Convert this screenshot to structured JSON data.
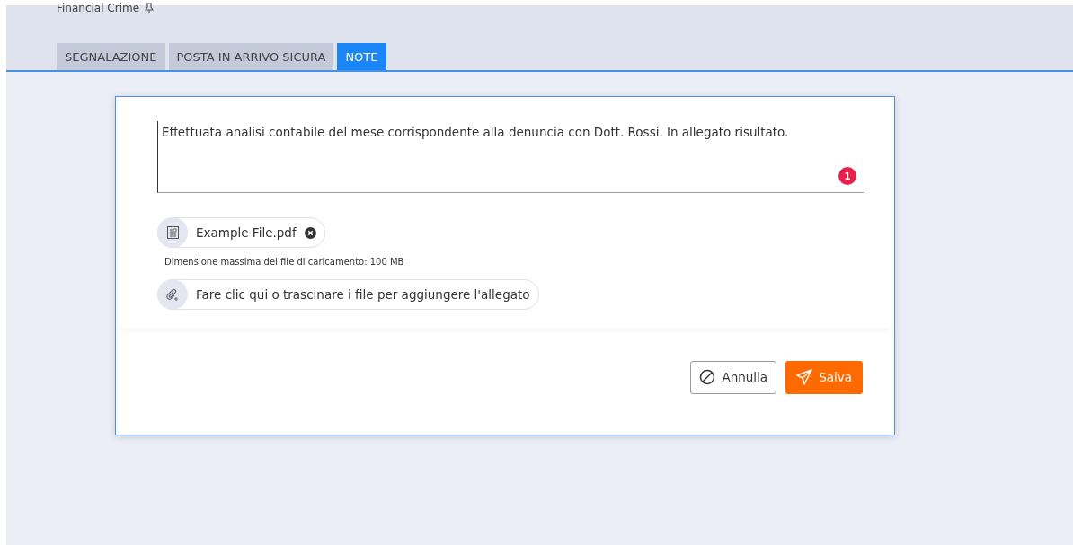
{
  "header": {
    "title": "Financial Crime"
  },
  "tabs": [
    {
      "label": "SEGNALAZIONE",
      "selected": false
    },
    {
      "label": "POSTA IN ARRIVO SICURA",
      "selected": false
    },
    {
      "label": "NOTE",
      "selected": true
    }
  ],
  "note": {
    "value": "Effettuata analisi contabile del mese corrispondente alla denuncia con Dott. Rossi. In allegato risultato.",
    "badge": "1"
  },
  "attachments": [
    {
      "name": "Example File.pdf"
    }
  ],
  "max_size_hint": "Dimensione massima del file di caricamento: 100 MB",
  "upload_label": "Fare clic qui o trascinare i file per aggiungere l'allegato",
  "buttons": [
    {
      "kind": "cancel",
      "label": "Annulla"
    },
    {
      "kind": "save",
      "label": "Salva"
    }
  ]
}
